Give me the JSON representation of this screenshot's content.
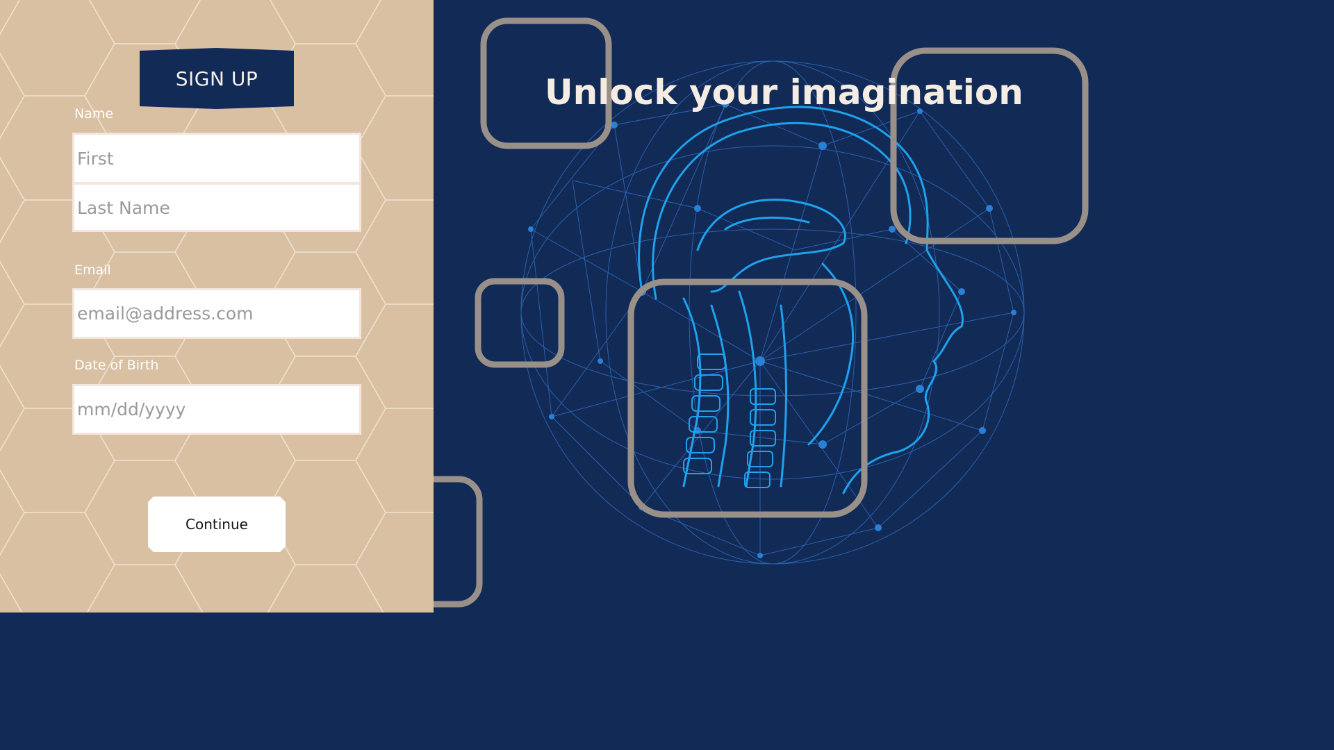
{
  "signup": {
    "title": "SIGN UP",
    "name_label": "Name",
    "first_placeholder": "First",
    "last_placeholder": "Last Name",
    "email_label": "Email",
    "email_placeholder": "email@address.com",
    "dob_label": "Date of Birth",
    "dob_placeholder": "mm/dd/yyyy",
    "continue_label": "Continue"
  },
  "hero": {
    "title": "Unlock your imagination"
  },
  "colors": {
    "left_background": "#d9c0a2",
    "right_background": "#122a56",
    "banner": "#122a56",
    "frame_outline": "#9a908a",
    "brain_blue": "#1e9be6"
  },
  "icons": {
    "hero_art": "brain-network-illustration"
  }
}
